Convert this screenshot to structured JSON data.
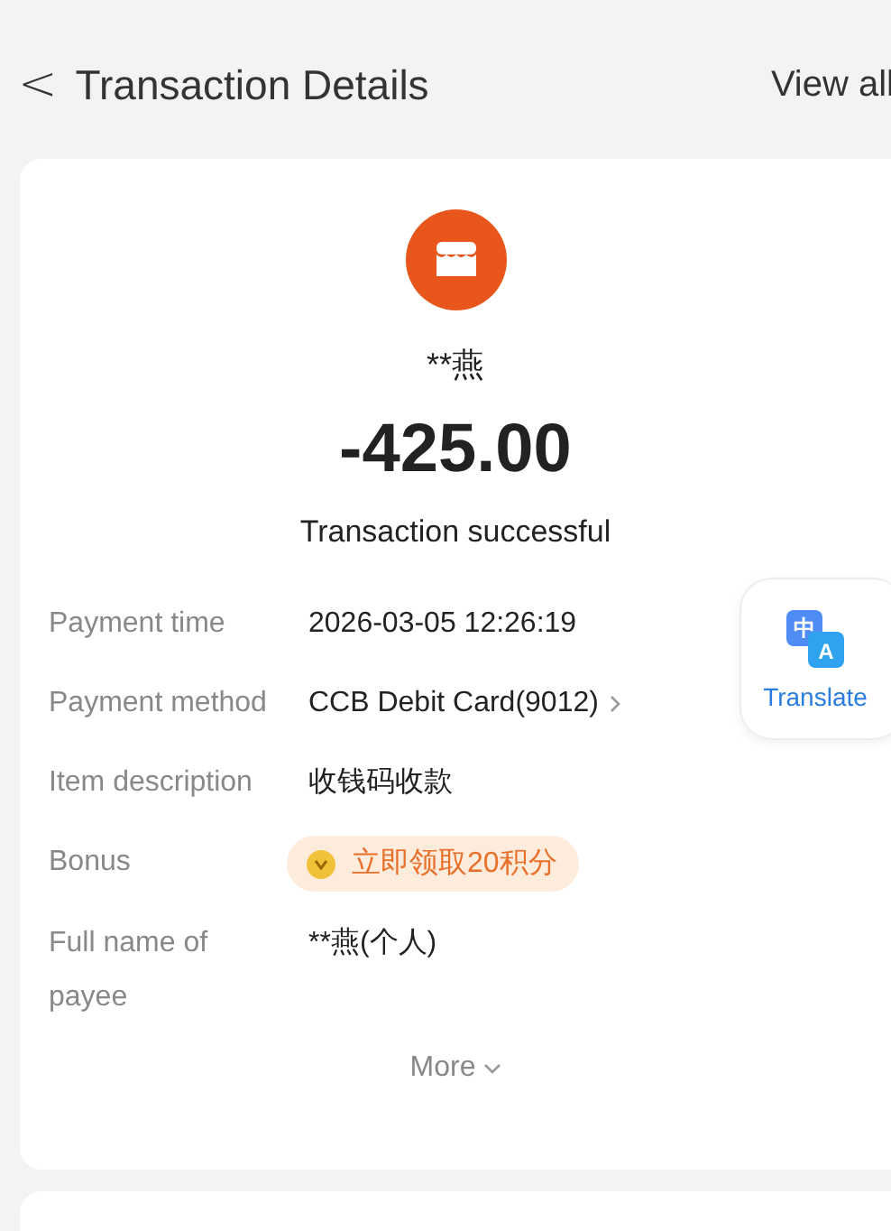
{
  "header": {
    "back": "<",
    "title": "Transaction Details",
    "action": "View all"
  },
  "merchant": {
    "name": "**燕"
  },
  "amount": "-425.00",
  "status": "Transaction successful",
  "details": [
    {
      "kind": "text",
      "label": "Payment time",
      "value": "2026-03-05 12:26:19"
    },
    {
      "kind": "link",
      "label": "Payment method",
      "value": "CCB Debit Card(9012)"
    },
    {
      "kind": "text",
      "label": "Item description",
      "value": "收钱码收款"
    },
    {
      "kind": "bonus",
      "label": "Bonus",
      "value": "立即领取20积分"
    },
    {
      "kind": "text",
      "label": "Full name of payee",
      "value": "**燕(个人)"
    }
  ],
  "more": "More",
  "translate": {
    "label": "Translate",
    "glyph_top": "中",
    "glyph_bottom": "A"
  }
}
